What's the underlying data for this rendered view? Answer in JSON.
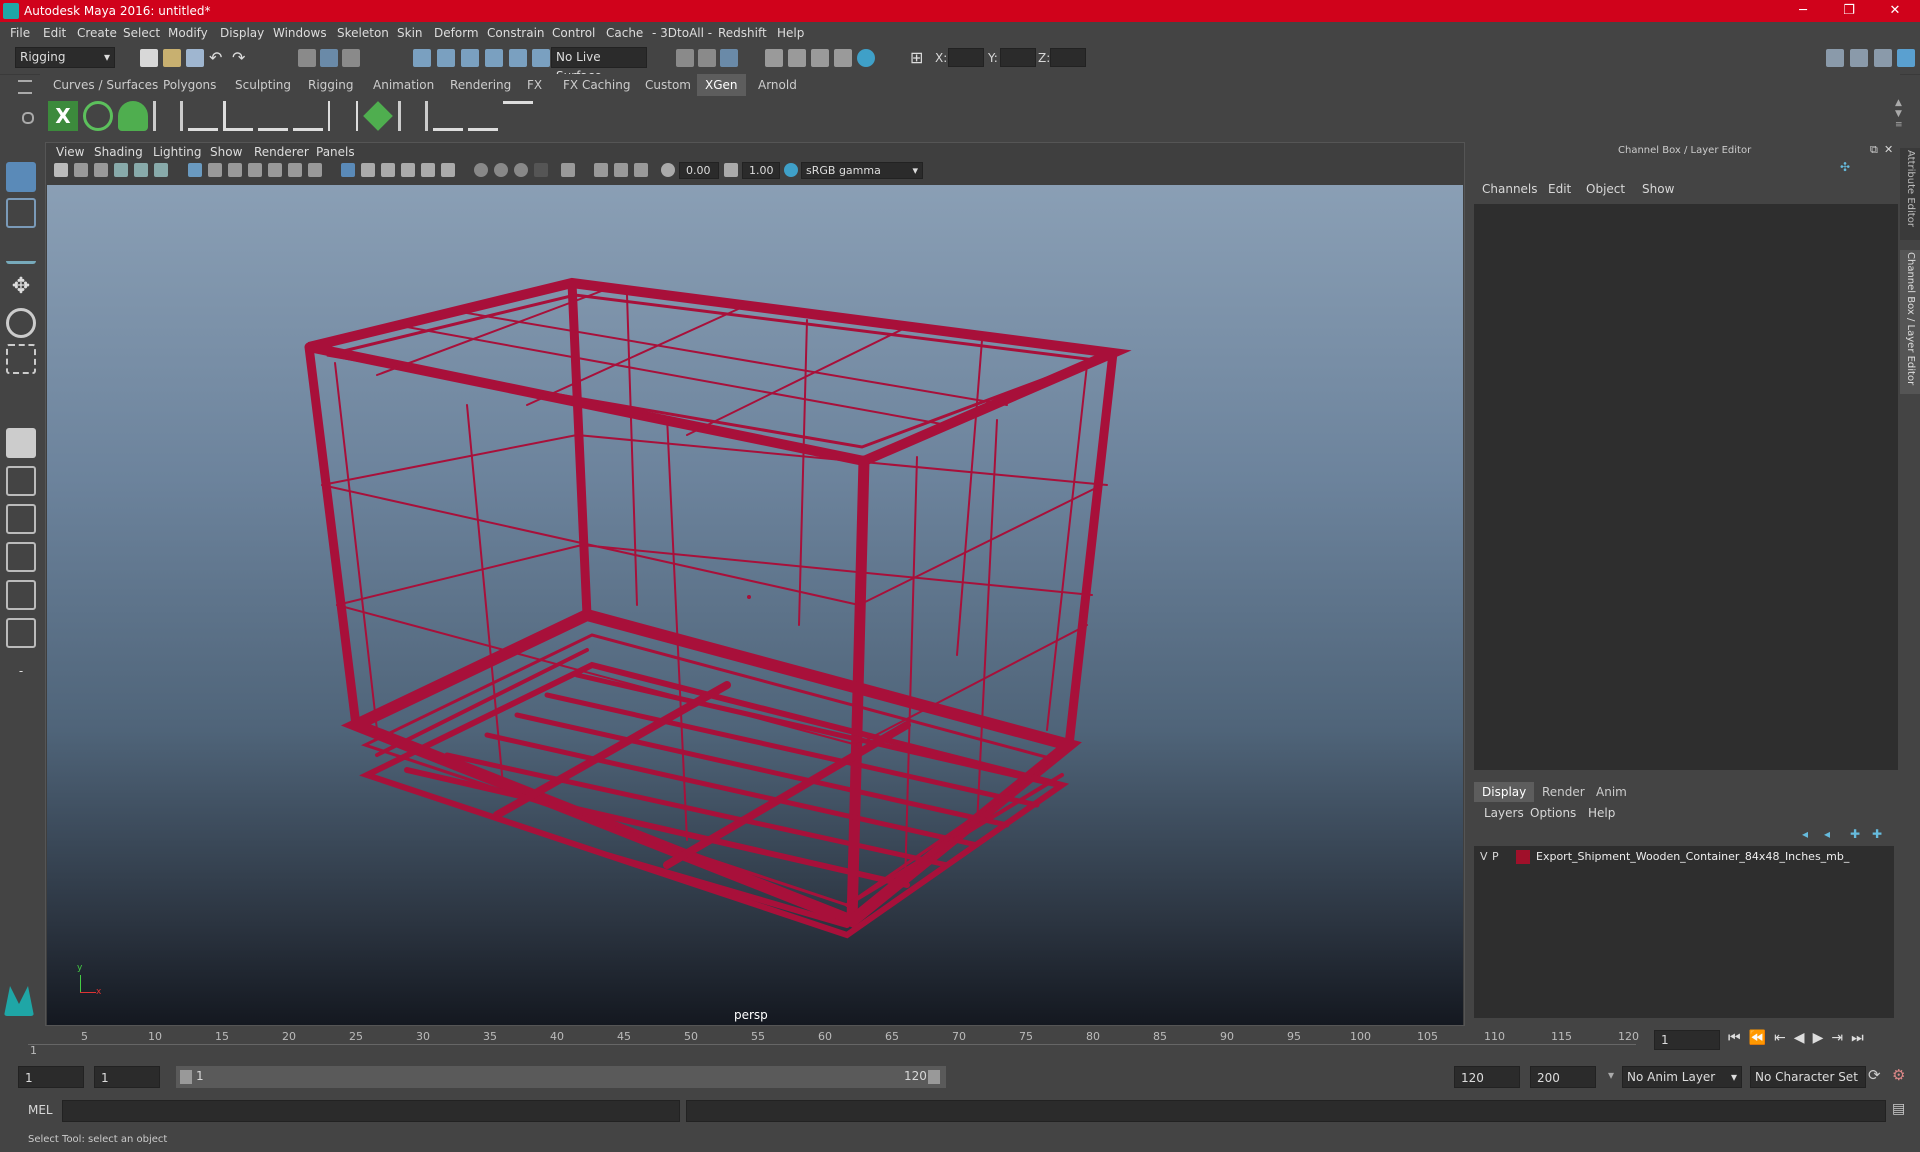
{
  "window": {
    "title": "Autodesk Maya 2016: untitled*",
    "minimize": "─",
    "maximize": "❐",
    "close": "✕"
  },
  "menubar": [
    "File",
    "Edit",
    "Create",
    "Select",
    "Modify",
    "Display",
    "Windows",
    "Skeleton",
    "Skin",
    "Deform",
    "Constrain",
    "Control",
    "Cache",
    "- 3DtoAll -",
    "Redshift",
    "Help"
  ],
  "toolbar": {
    "mode": "Rigging",
    "live_surface": "No Live Surface",
    "x_label": "X:",
    "y_label": "Y:",
    "z_label": "Z:"
  },
  "shelf_tabs": [
    "Curves / Surfaces",
    "Polygons",
    "Sculpting",
    "Rigging",
    "Animation",
    "Rendering",
    "FX",
    "FX Caching",
    "Custom",
    "XGen",
    "Arnold"
  ],
  "active_shelf": "XGen",
  "viewport": {
    "menu": [
      "View",
      "Shading",
      "Lighting",
      "Show",
      "Renderer",
      "Panels"
    ],
    "exposure": "0.00",
    "gamma": "1.00",
    "color_space": "sRGB gamma",
    "camera_label": "persp",
    "axis_y": "y",
    "axis_x": "x"
  },
  "channel_box": {
    "title": "Channel Box / Layer Editor",
    "menu": [
      "Channels",
      "Edit",
      "Object",
      "Show"
    ],
    "side_tab_attr": "Attribute Editor",
    "side_tab_cb": "Channel Box / Layer Editor"
  },
  "layer_editor": {
    "tabs": [
      "Display",
      "Render",
      "Anim"
    ],
    "active_tab": "Display",
    "menu": [
      "Layers",
      "Options",
      "Help"
    ],
    "layer": {
      "v": "V",
      "p": "P",
      "name": "Export_Shipment_Wooden_Container_84x48_Inches_mb_",
      "color": "#a0102a"
    }
  },
  "timeline": {
    "ticks": [
      "5",
      "10",
      "15",
      "20",
      "25",
      "30",
      "35",
      "40",
      "45",
      "50",
      "55",
      "60",
      "65",
      "70",
      "75",
      "80",
      "85",
      "90",
      "95",
      "100",
      "105",
      "110",
      "115",
      "120"
    ],
    "start_marker": "1",
    "current_frame": "1"
  },
  "range": {
    "start": "1",
    "playback_start": "1",
    "slider_start": "1",
    "slider_end": "120",
    "playback_end": "120",
    "end": "200",
    "anim_layer": "No Anim Layer",
    "character_set": "No Character Set"
  },
  "command_line": {
    "lang": "MEL"
  },
  "help_line": "Select Tool: select an object",
  "colors": {
    "title_bar": "#d0021b",
    "wireframe": "#a8103a",
    "viewport_top": "#8a9fb5",
    "viewport_bottom": "#141820"
  }
}
